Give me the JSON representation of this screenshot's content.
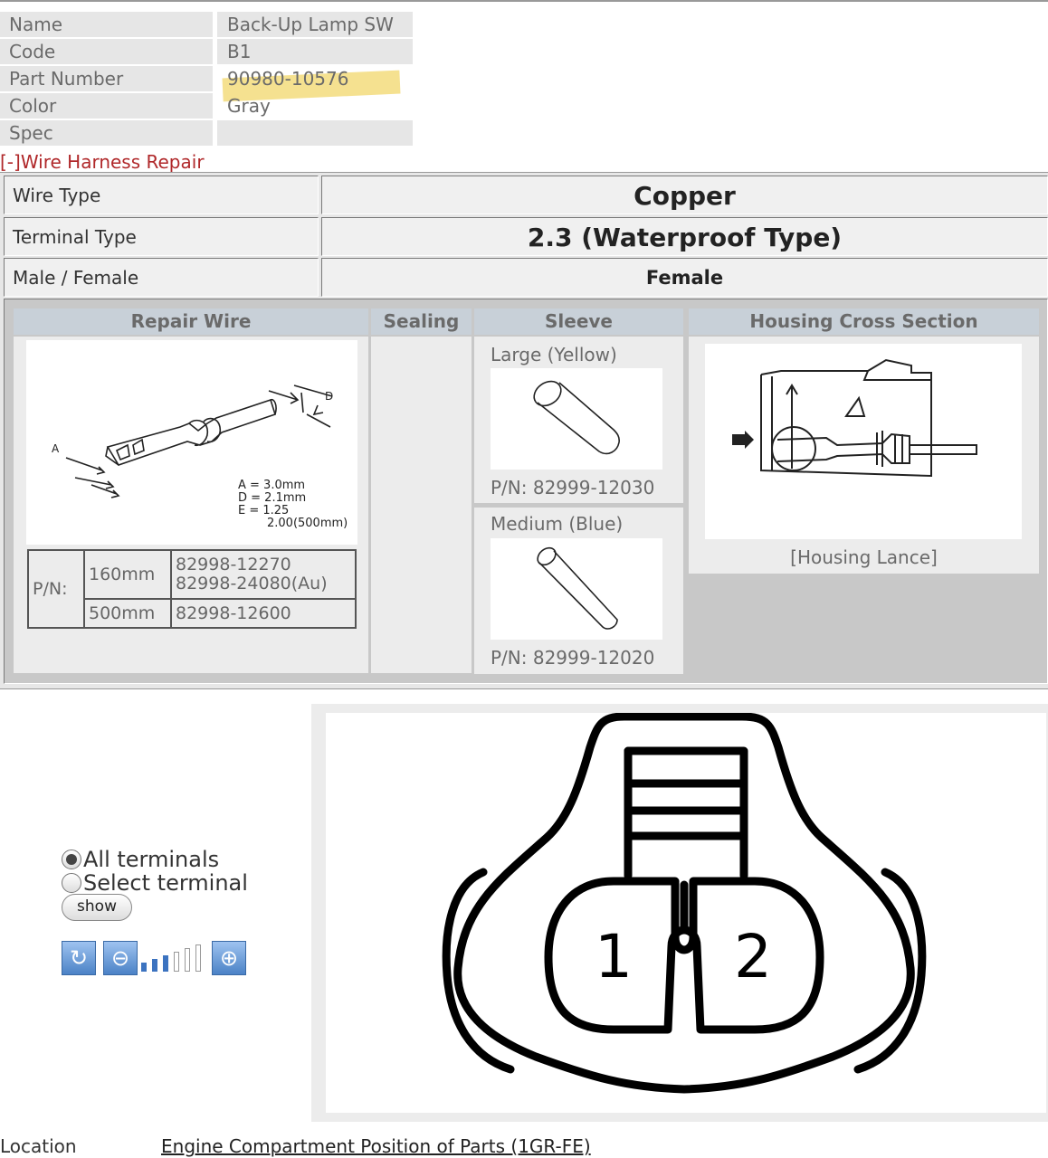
{
  "info": {
    "name_label": "Name",
    "name_value": "Back-Up Lamp SW",
    "code_label": "Code",
    "code_value": "B1",
    "part_label": "Part Number",
    "part_value": "90980-10576",
    "color_label": "Color",
    "color_value": "Gray",
    "spec_label": "Spec",
    "spec_value": ""
  },
  "harness": {
    "toggle": "[-]Wire Harness Repair",
    "wire_type_label": "Wire Type",
    "wire_type_value": "Copper",
    "terminal_type_label": "Terminal Type",
    "terminal_type_value": "2.3 (Waterproof Type)",
    "male_female_label": "Male / Female",
    "male_female_value": "Female",
    "headers": {
      "repair_wire": "Repair Wire",
      "sealing": "Sealing",
      "sleeve": "Sleeve",
      "housing": "Housing Cross Section"
    },
    "terminal_dims": {
      "a_tag": "A",
      "d_tag": "D",
      "a": "A = 3.0mm",
      "d": "D = 2.1mm",
      "e": "E = 1.25",
      "e2": "2.00(500mm)"
    },
    "pn_label": "P/N:",
    "pn_rows": [
      {
        "length": "160mm",
        "numbers": [
          "82998-12270",
          "82998-24080(Au)"
        ]
      },
      {
        "length": "500mm",
        "numbers": [
          "82998-12600"
        ]
      }
    ],
    "sleeves": [
      {
        "label": "Large (Yellow)",
        "pn": "P/N: 82999-12030"
      },
      {
        "label": "Medium (Blue)",
        "pn": "P/N: 82999-12020"
      }
    ],
    "housing_caption": "[Housing Lance]"
  },
  "controls": {
    "all_terminals": "All terminals",
    "select_terminal": "Select terminal",
    "show": "show",
    "zoom_level": 3,
    "zoom_steps": 6
  },
  "connector": {
    "pin1": "1",
    "pin2": "2"
  },
  "location": {
    "label": "Location",
    "link": "Engine Compartment  Position of Parts (1GR-FE)"
  }
}
